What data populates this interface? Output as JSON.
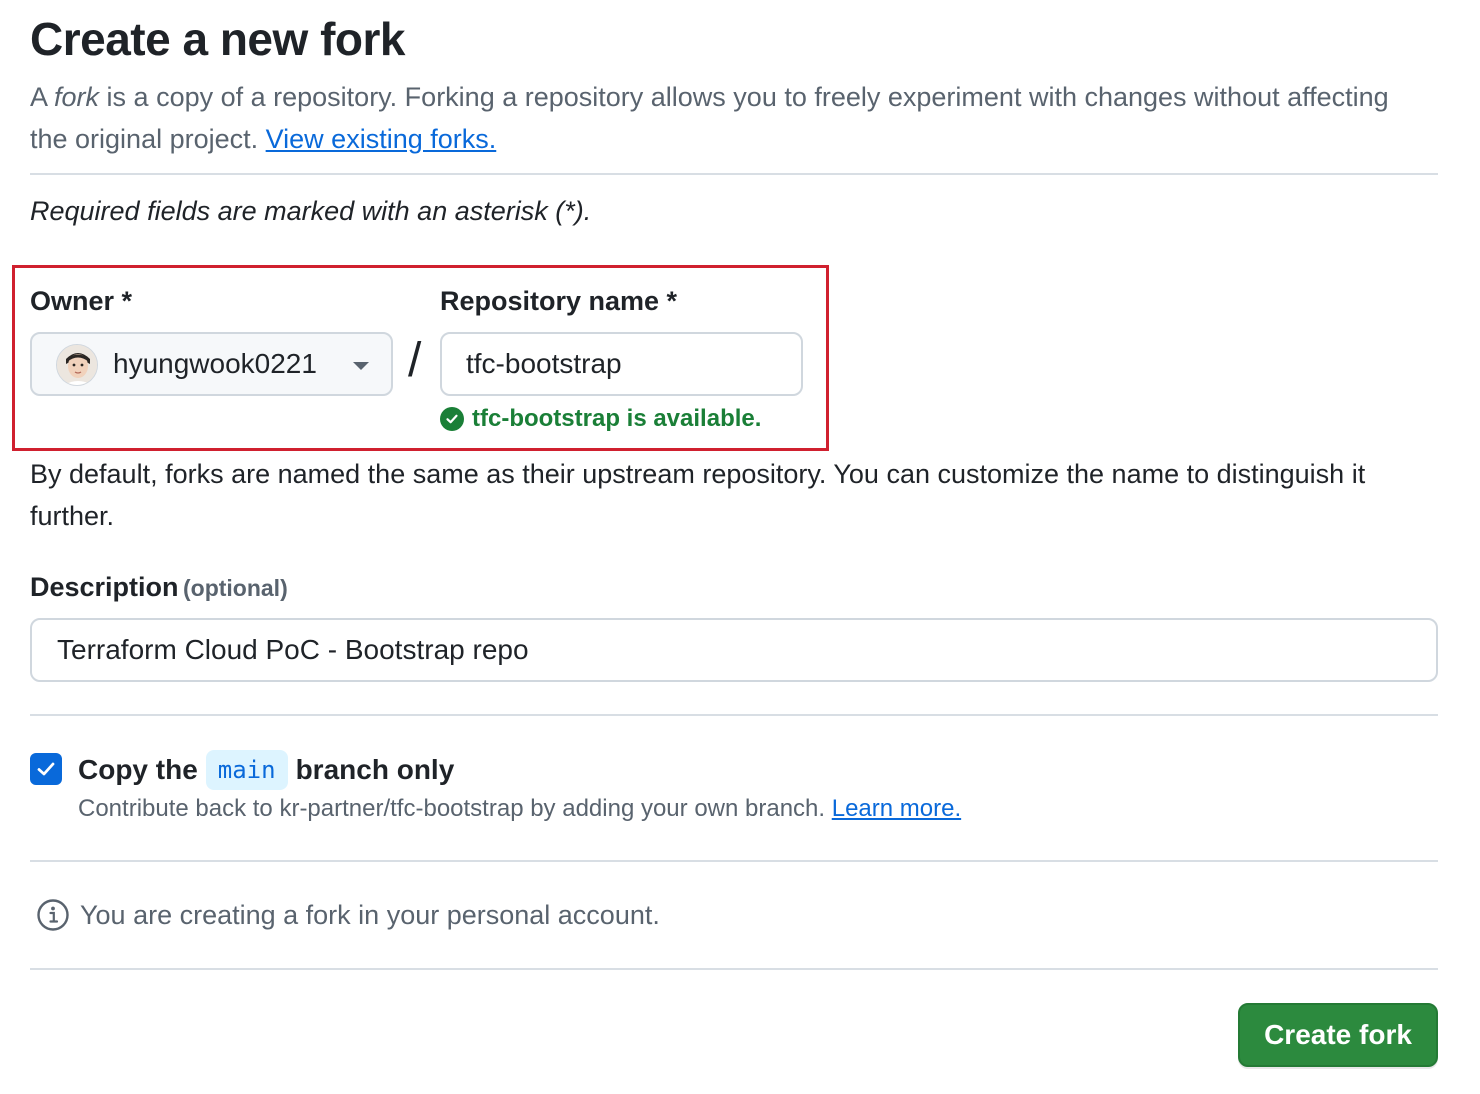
{
  "page": {
    "title": "Create a new fork",
    "intro_prefix": "A ",
    "intro_fork_word": "fork",
    "intro_suffix": " is a copy of a repository. Forking a repository allows you to freely experiment with changes without affecting the original project. ",
    "view_forks_link": "View existing forks.",
    "required_note": "Required fields are marked with an asterisk (*)."
  },
  "owner": {
    "label": "Owner *",
    "value": "hyungwook0221",
    "avatar_icon": "user-avatar"
  },
  "separator": "/",
  "repository": {
    "label": "Repository name *",
    "value": "tfc-bootstrap",
    "availability": "tfc-bootstrap is available.",
    "status_color": "#1a7f37"
  },
  "help_text": "By default, forks are named the same as their upstream repository. You can customize the name to distinguish it further.",
  "description": {
    "label": "Description",
    "optional": "(optional)",
    "value": "Terraform Cloud PoC - Bootstrap repo"
  },
  "copy_branch": {
    "checked": true,
    "label_before": "Copy the",
    "branch": "main",
    "label_after": "branch only",
    "help": "Contribute back to kr-partner/tfc-bootstrap by adding your own branch. ",
    "learn_more": "Learn more."
  },
  "info": {
    "icon": "info-icon",
    "text": "You are creating a fork in your personal account."
  },
  "actions": {
    "create_label": "Create fork",
    "create_color": "#2c8a3e"
  },
  "highlight_color": "#d0202f"
}
